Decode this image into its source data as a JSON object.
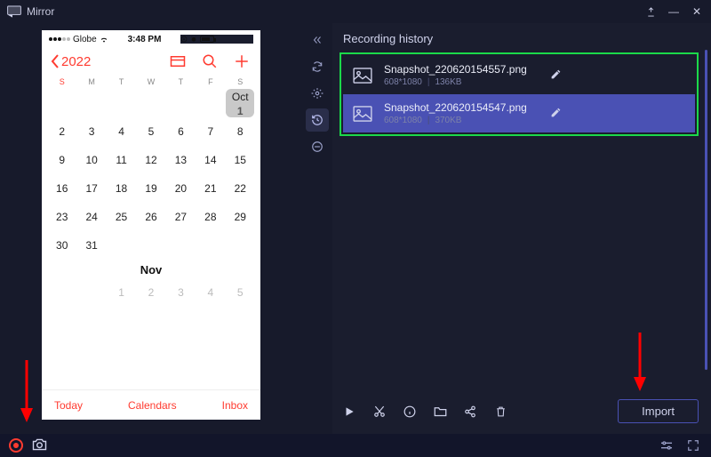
{
  "app": {
    "title": "Mirror"
  },
  "phone": {
    "carrier": "Globe",
    "time": "3:48 PM",
    "year": "2022",
    "dow": [
      "S",
      "M",
      "T",
      "W",
      "T",
      "F",
      "S"
    ],
    "month_badge": {
      "label": "Oct",
      "day": "1"
    },
    "month2": "Nov",
    "bottom": {
      "today": "Today",
      "calendars": "Calendars",
      "inbox": "Inbox"
    }
  },
  "panel": {
    "title": "Recording history",
    "items": [
      {
        "name": "Snapshot_220620154557.png",
        "res": "608*1080",
        "size": "136KB"
      },
      {
        "name": "Snapshot_220620154547.png",
        "res": "608*1080",
        "size": "370KB"
      }
    ],
    "import": "Import"
  }
}
